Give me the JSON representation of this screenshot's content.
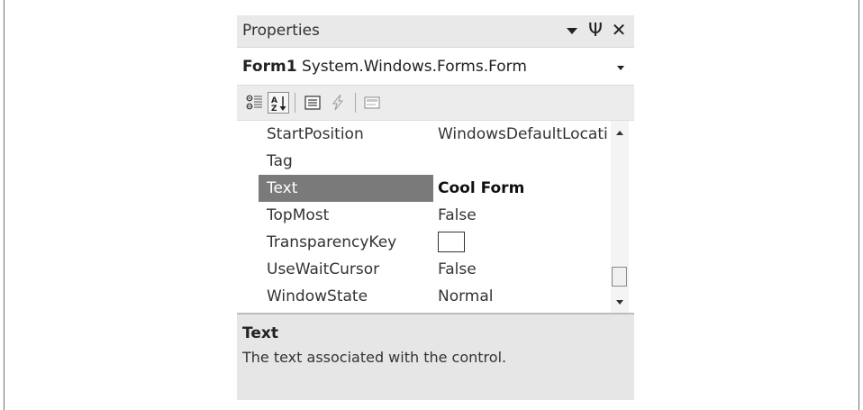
{
  "panel": {
    "title": "Properties",
    "title_icons": [
      "dropdown-arrow-icon",
      "pin-icon",
      "close-icon"
    ],
    "pin_glyph": "Ψ",
    "close_glyph": "✕"
  },
  "object_selector": {
    "name": "Form1",
    "type": "System.Windows.Forms.Form"
  },
  "toolbar": {
    "buttons": [
      "categorized-icon",
      "alphabetical-icon",
      "properties-icon",
      "events-icon",
      "property-pages-icon"
    ],
    "active": "alphabetical-icon"
  },
  "grid": {
    "rows": [
      {
        "name": "StartPosition",
        "value": "WindowsDefaultLocati"
      },
      {
        "name": "Tag",
        "value": ""
      },
      {
        "name": "Text",
        "value": "Cool Form",
        "selected": true
      },
      {
        "name": "TopMost",
        "value": "False"
      },
      {
        "name": "TransparencyKey",
        "value": "",
        "swatch": true
      },
      {
        "name": "UseWaitCursor",
        "value": "False"
      },
      {
        "name": "WindowState",
        "value": "Normal"
      }
    ]
  },
  "description": {
    "title": "Text",
    "text": "The text associated with the control."
  },
  "colors": {
    "selection": "#7a7a7a",
    "toolbar_bg": "#ececec",
    "description_bg": "#e6e6e6"
  }
}
